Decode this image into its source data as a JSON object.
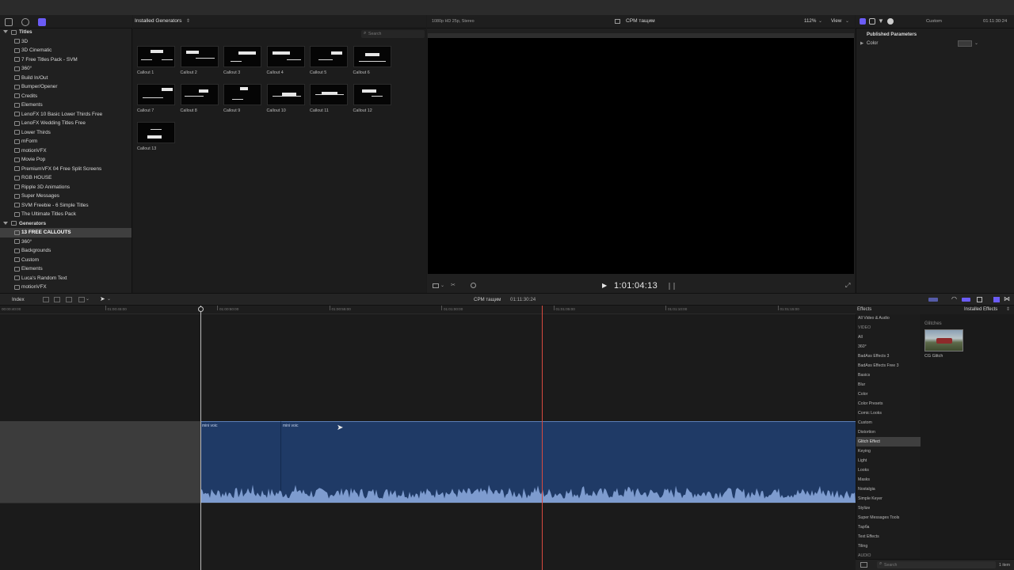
{
  "colors": {
    "accent": "#6b5cf6",
    "playhead": "#d84a3f",
    "skimmer": "#bbbbbb",
    "clip": "#1f3a66",
    "waveform": "#7e9ccf"
  },
  "browser": {
    "title": "Installed Generators",
    "search_placeholder": "Search"
  },
  "library": {
    "titles_section": "Titles",
    "titles": [
      "3D",
      "3D Cinematic",
      "7 Free Titles Pack - SVM",
      "360°",
      "Build In/Out",
      "Bumper/Opener",
      "Credits",
      "Elements",
      "LenoFX 10 Basic Lower Thirds Free",
      "LenoFX Wedding Titles Free",
      "Lower Thirds",
      "mForm",
      "motionVFX",
      "Movie Pop",
      "PremiumVFX 04 Free Split Screens",
      "RGB HOUSE",
      "Ripple 3D Animations",
      "Super Messages",
      "SVM Freebie - 6 Simple Titles",
      "The Ultimate Titles Pack"
    ],
    "generators_section": "Generators",
    "generators": [
      "13 FREE CALLOUTS",
      "360°",
      "Backgrounds",
      "Custom",
      "Elements",
      "Luca's Random Text",
      "motionVFX"
    ]
  },
  "thumbnails": [
    "Callout 1",
    "Callout 2",
    "Callout 3",
    "Callout 4",
    "Callout 5",
    "Callout 6",
    "Callout 7",
    "Callout 8",
    "Callout 9",
    "Callout 10",
    "Callout 11",
    "Callout 12",
    "Callout 13"
  ],
  "viewer": {
    "format": "1080p HD 25p, Stereo",
    "project": "СРМ тащим",
    "zoom": "112%",
    "view_label": "View",
    "timecode": "1:01:04:13"
  },
  "inspector": {
    "label": "Custom",
    "duration": "01:11:30:24",
    "section": "Published Parameters",
    "param": "Color"
  },
  "timeline": {
    "index_label": "Index",
    "project": "СРМ тащим",
    "duration": "01:11:30:24",
    "ruler": [
      "00:00:40:00",
      "01:00:45:00",
      "01:00:50:00",
      "01:00:55:00",
      "01:01:00:00",
      "01:01:05:00",
      "01:01:10:00",
      "01:01:15:00"
    ],
    "clips": [
      "mini voic",
      "mini voic"
    ]
  },
  "effects": {
    "header": "Effects",
    "installed_label": "Installed Effects",
    "items": [
      "All Video & Audio",
      "VIDEO",
      "All",
      "360°",
      "BadAss Effects 3",
      "BadAss Effects Free 3",
      "Basics",
      "Blur",
      "Color",
      "Color Presets",
      "Comic Looks",
      "Custom",
      "Distortion",
      "Glitch Effect",
      "Keying",
      "Light",
      "Looks",
      "Masks",
      "Nostalgia",
      "Simple Keyer",
      "Stylize",
      "Super Messages Tools",
      "Тарба",
      "Text Effects",
      "Tiling",
      "AUDIO"
    ],
    "category_title": "Glitches",
    "effect_name": "CG Glitch",
    "search_placeholder": "Search",
    "count": "1 item"
  }
}
